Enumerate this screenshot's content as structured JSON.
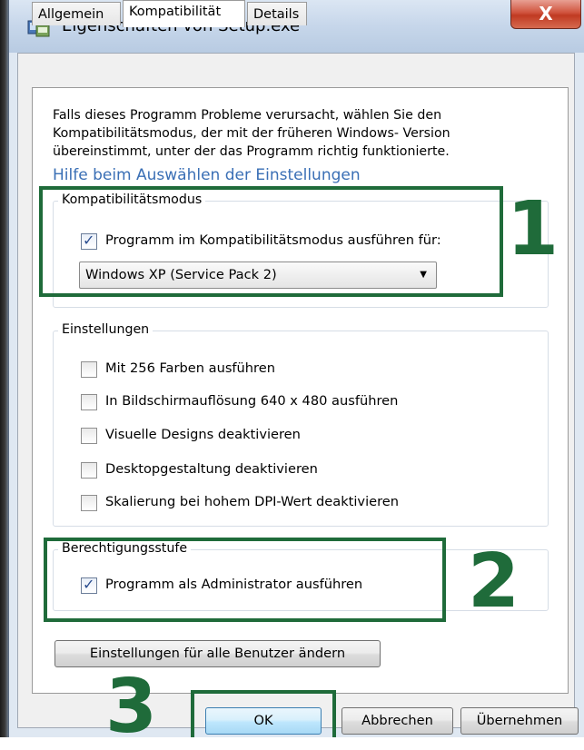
{
  "window": {
    "title": "Eigenschaften von Setup.exe",
    "close_label": "X"
  },
  "tabs": [
    {
      "label": "Allgemein",
      "active": false
    },
    {
      "label": "Kompatibilität",
      "active": true
    },
    {
      "label": "Details",
      "active": false
    }
  ],
  "intro": {
    "text": "Falls dieses Programm Probleme verursacht, wählen Sie den Kompatibilitätsmodus, der mit der früheren Windows- Version übereinstimmt, unter der das Programm richtig funktionierte.",
    "help_link": "Hilfe beim Auswählen der Einstellungen"
  },
  "compat_group": {
    "label": "Kompatibilitätsmodus",
    "checkbox_label": "Programm im Kompatibilitätsmodus ausführen für:",
    "checked": true,
    "select_value": "Windows XP (Service Pack 2)"
  },
  "settings_group": {
    "label": "Einstellungen",
    "items": [
      {
        "label": "Mit 256 Farben ausführen",
        "checked": false
      },
      {
        "label": "In Bildschirmauflösung 640 x 480 ausführen",
        "checked": false
      },
      {
        "label": "Visuelle Designs deaktivieren",
        "checked": false
      },
      {
        "label": "Desktopgestaltung deaktivieren",
        "checked": false
      },
      {
        "label": "Skalierung bei hohem DPI-Wert deaktivieren",
        "checked": false
      }
    ]
  },
  "privilege_group": {
    "label": "Berechtigungsstufe",
    "checkbox_label": "Programm als Administrator ausführen",
    "checked": true
  },
  "buttons": {
    "all_users": "Einstellungen für alle Benutzer ändern",
    "ok": "OK",
    "cancel": "Abbrechen",
    "apply": "Übernehmen"
  },
  "annotations": {
    "step1": "1",
    "step2": "2",
    "step3": "3",
    "color": "#1f6b3a"
  }
}
